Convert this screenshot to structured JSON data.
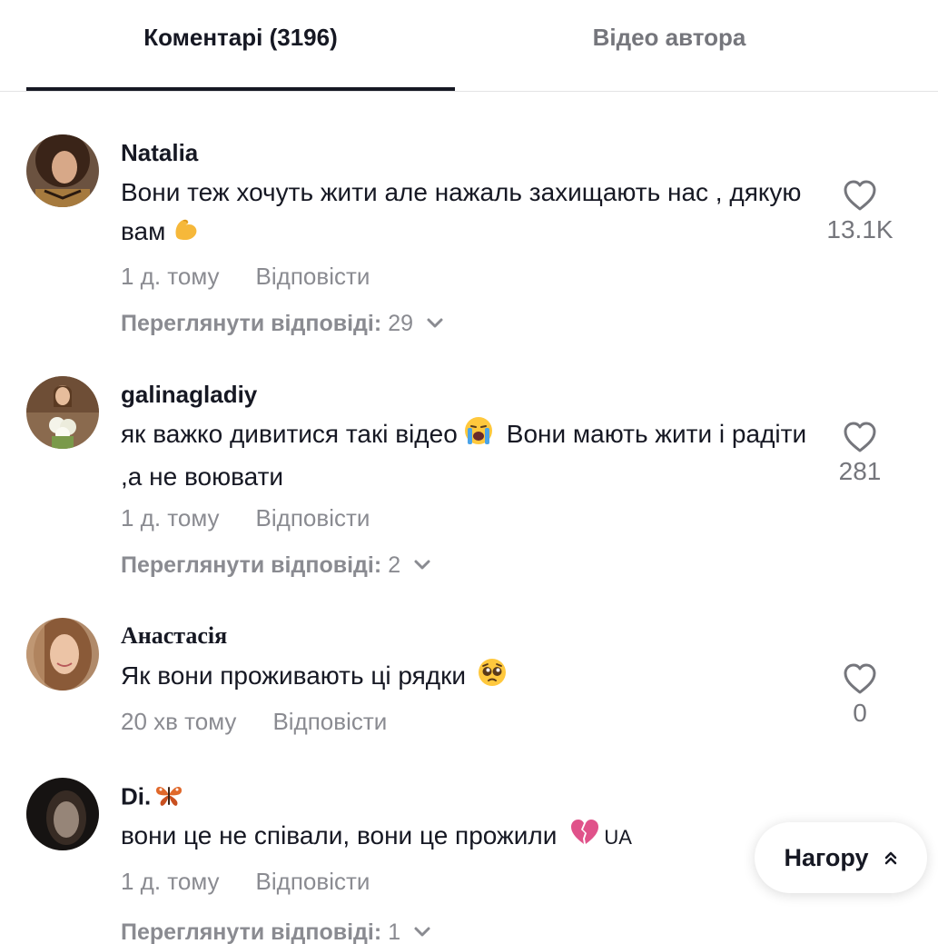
{
  "tabs": {
    "comments_label": "Коментарі (3196)",
    "author_videos_label": "Відео автора"
  },
  "comments": [
    {
      "username": "Natalia",
      "text": "Вони теж хочуть жити але нажаль захищають нас , дякую вам",
      "emoji": "flexed-biceps",
      "time": "1 д. тому",
      "reply_label": "Відповісти",
      "view_replies_label": "Переглянути відповіді:",
      "replies_count": "29",
      "likes": "13.1K"
    },
    {
      "username": "galinagladiy",
      "text_part1": "як важко дивитися такі відео",
      "emoji": "loudly-crying-face",
      "text_part2": "Вони мають жити і радіти ,а не воювати",
      "time": "1 д. тому",
      "reply_label": "Відповісти",
      "view_replies_label": "Переглянути відповіді:",
      "replies_count": "2",
      "likes": "281"
    },
    {
      "username": "Анастасія",
      "text": "Як вони проживають ці рядки",
      "emoji": "pleading-face",
      "time": "20 хв тому",
      "reply_label": "Відповісти",
      "likes": "0"
    },
    {
      "username": "Di.",
      "username_emoji": "butterfly",
      "text": "вони це не співали, вони це прожили",
      "emoji": "broken-heart",
      "flag_text": "UA",
      "time": "1 д. тому",
      "reply_label": "Відповісти",
      "view_replies_label": "Переглянути відповіді:",
      "replies_count": "1"
    }
  ],
  "back_to_top_label": "Нагору",
  "colors": {
    "primary_text": "#161823",
    "secondary_text": "#8a8b91",
    "divider": "#e3e3e5"
  }
}
